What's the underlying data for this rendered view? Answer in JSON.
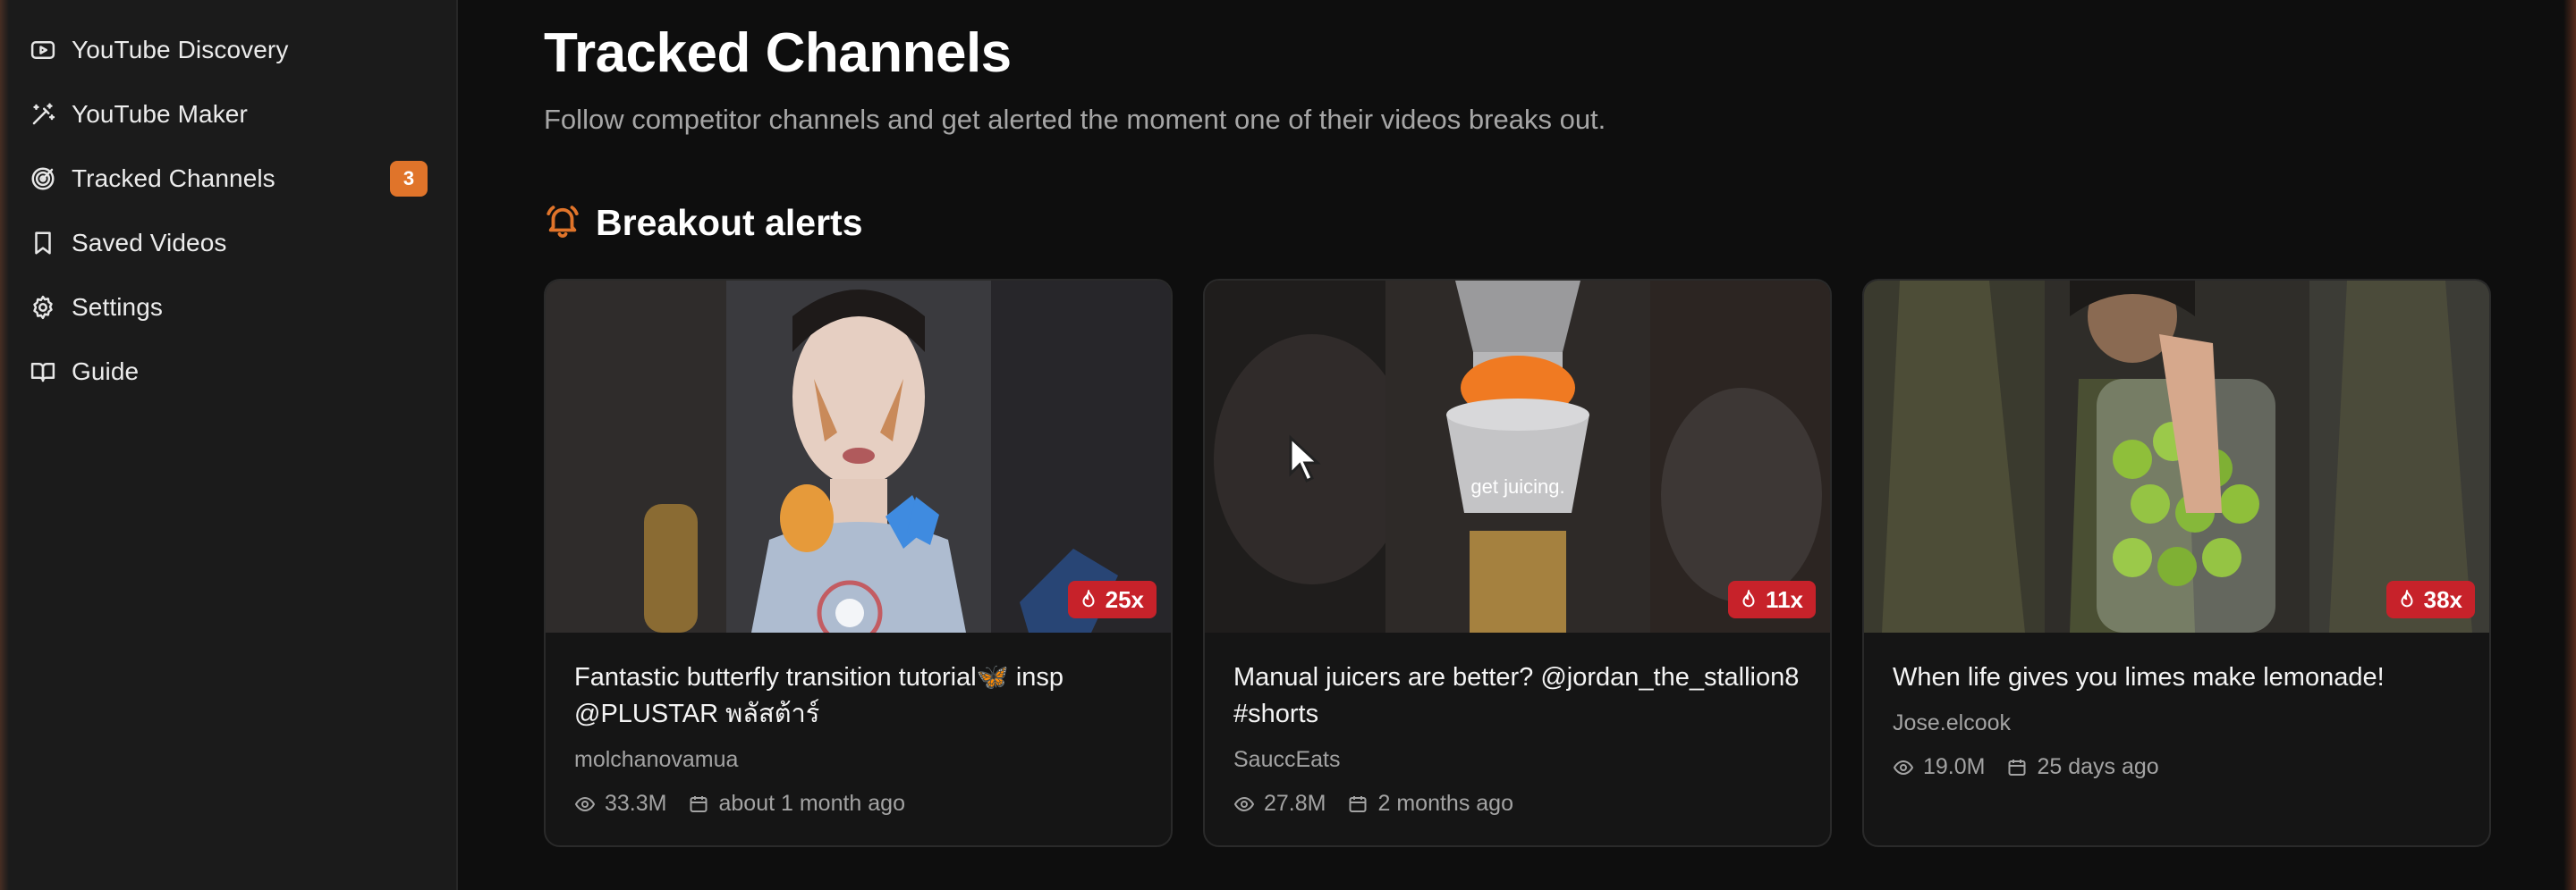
{
  "sidebar": {
    "items": [
      {
        "label": "YouTube Discovery",
        "icon": "youtube-icon"
      },
      {
        "label": "YouTube Maker",
        "icon": "magic-wand-icon"
      },
      {
        "label": "Tracked Channels",
        "icon": "target-icon",
        "badge": "3"
      },
      {
        "label": "Saved Videos",
        "icon": "bookmark-icon"
      },
      {
        "label": "Settings",
        "icon": "gear-icon"
      },
      {
        "label": "Guide",
        "icon": "book-icon"
      }
    ]
  },
  "main": {
    "title": "Tracked Channels",
    "subtitle": "Follow competitor channels and get alerted the moment one of their videos breaks out.",
    "section": {
      "title": "Breakout alerts",
      "icon": "bell-icon"
    },
    "cards": [
      {
        "multiplier": "25x",
        "title": "Fantastic butterfly transition tutorial🦋 insp @PLUSTAR พลัสต้าร์",
        "channel": "molchanovamua",
        "views": "33.3M",
        "date": "about 1 month ago"
      },
      {
        "multiplier": "11x",
        "title": "Manual juicers are better? @jordan_the_stallion8 #shorts",
        "channel": "SauccEats",
        "views": "27.8M",
        "date": "2 months ago",
        "thumb_caption": "get juicing."
      },
      {
        "multiplier": "38x",
        "title": "When life gives you limes make lemonade!",
        "channel": "Jose.elcook",
        "views": "19.0M",
        "date": "25 days ago"
      }
    ]
  },
  "colors": {
    "accent": "#e0742a",
    "multiplier_badge": "#c7222a",
    "background": "#0e0e0e",
    "sidebar": "#1b1b1b"
  }
}
